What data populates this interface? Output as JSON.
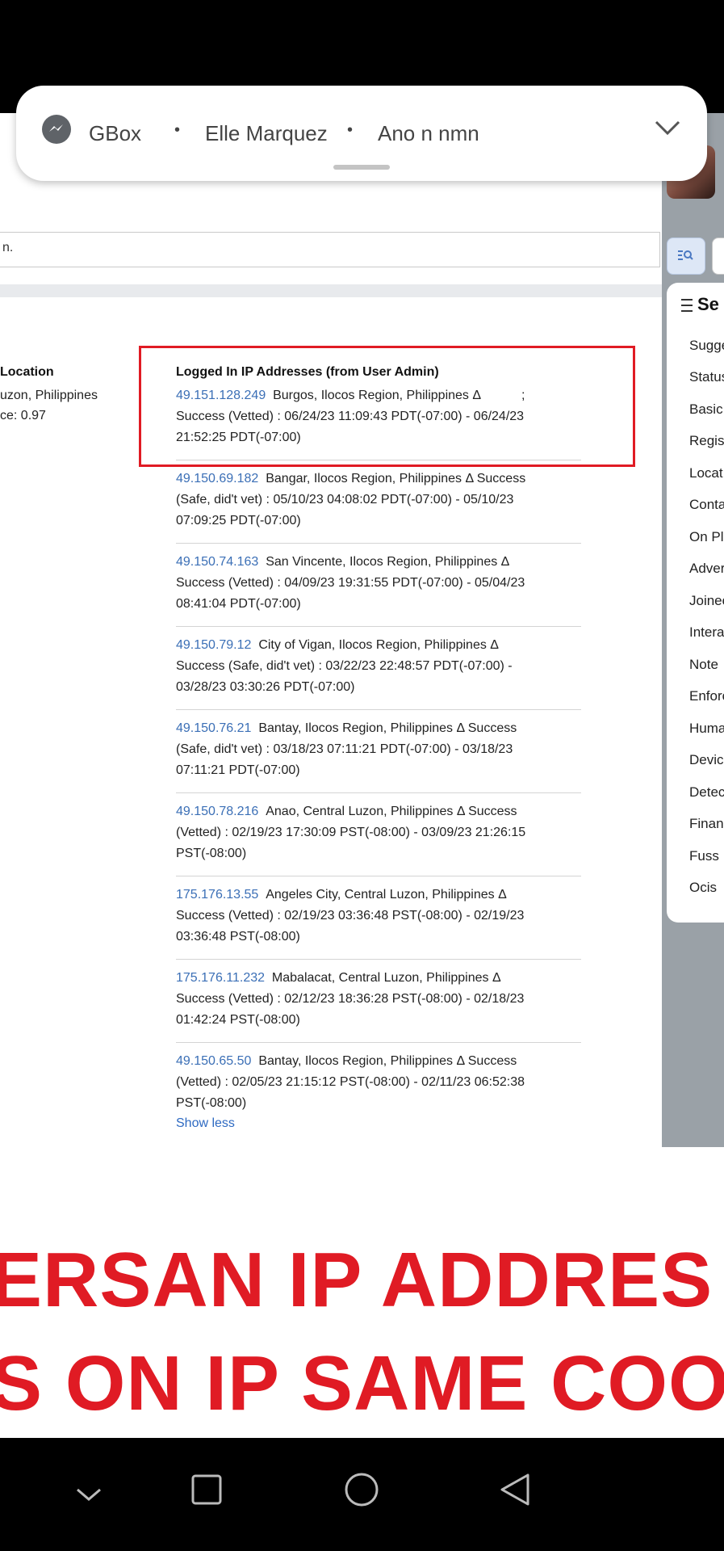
{
  "notification": {
    "app": "GBox",
    "sender": "Elle Marquez",
    "message": "Ano n nmn",
    "icons": {
      "app": "messenger-icon",
      "expand": "chevron-down-icon"
    }
  },
  "search": {
    "value": "n."
  },
  "location_column": {
    "header": "Location",
    "value": "uzon, Philippines",
    "confidence": "ce: 0.97"
  },
  "ip_section": {
    "header": "Logged In IP Addresses (from User Admin)",
    "entries": [
      {
        "ip": "49.151.128.249",
        "line1": "Burgos, Ilocos Region, Philippines   Δ",
        "mark": ";",
        "line2": "Success (Vetted) : 06/24/23 11:09:43 PDT(-07:00) - 06/24/23",
        "line3": "21:52:25 PDT(-07:00)"
      },
      {
        "ip": "49.150.69.182",
        "line1": "Bangar, Ilocos Region, Philippines   Δ Success",
        "line2": "(Safe, did't vet) : 05/10/23 04:08:02 PDT(-07:00) - 05/10/23",
        "line3": "07:09:25 PDT(-07:00)"
      },
      {
        "ip": "49.150.74.163",
        "line1": "San Vincente, Ilocos Region, Philippines   Δ",
        "line2": "Success (Vetted) : 04/09/23 19:31:55 PDT(-07:00) - 05/04/23",
        "line3": "08:41:04 PDT(-07:00)"
      },
      {
        "ip": "49.150.79.12",
        "line1": "City of Vigan, Ilocos Region, Philippines   Δ",
        "line2": "Success (Safe, did't vet) : 03/22/23 22:48:57 PDT(-07:00) -",
        "line3": "03/28/23 03:30:26 PDT(-07:00)"
      },
      {
        "ip": "49.150.76.21",
        "line1": "Bantay, Ilocos Region, Philippines   Δ Success",
        "line2": "(Safe, did't vet) : 03/18/23 07:11:21 PDT(-07:00) - 03/18/23",
        "line3": "07:11:21 PDT(-07:00)"
      },
      {
        "ip": "49.150.78.216",
        "line1": "Anao, Central Luzon, Philippines   Δ Success",
        "line2": "(Vetted) : 02/19/23 17:30:09 PST(-08:00) - 03/09/23 21:26:15",
        "line3": "PST(-08:00)"
      },
      {
        "ip": "175.176.13.55",
        "line1": "Angeles City, Central Luzon, Philippines   Δ",
        "line2": "Success (Vetted) : 02/19/23 03:36:48 PST(-08:00) - 02/19/23",
        "line3": "03:36:48 PST(-08:00)"
      },
      {
        "ip": "175.176.11.232",
        "line1": "Mabalacat, Central Luzon, Philippines   Δ",
        "line2": "Success (Vetted) : 02/12/23 18:36:28 PST(-08:00) - 02/18/23",
        "line3": "01:42:24 PST(-08:00)"
      },
      {
        "ip": "49.150.65.50",
        "line1": "Bantay, Ilocos Region, Philippines   Δ Success",
        "line2": "(Vetted) : 02/05/23 21:15:12 PST(-08:00) - 02/11/23 06:52:38",
        "line3": "PST(-08:00)"
      }
    ],
    "show_less": "Show less"
  },
  "side_panel": {
    "header": "Se",
    "items": [
      "Sugge",
      "Status",
      "Basic",
      "Regist",
      "Locat",
      "Conta",
      "On Pla",
      "Adver",
      "Joinec",
      "Intera",
      "Note",
      "Enforc",
      "Huma",
      "Devic",
      "Detec",
      "Financ",
      "Fuss",
      "Ocis"
    ]
  },
  "banner": {
    "line1": "ERSAN IP ADDRES",
    "line2": "S ON IP SAME COO"
  },
  "colors": {
    "highlight": "#e01b24",
    "link": "#3b6fb6",
    "banner_text": "#e01b24"
  },
  "nav_icons": [
    "chevron-down-icon",
    "recents-icon",
    "home-icon",
    "back-icon"
  ]
}
